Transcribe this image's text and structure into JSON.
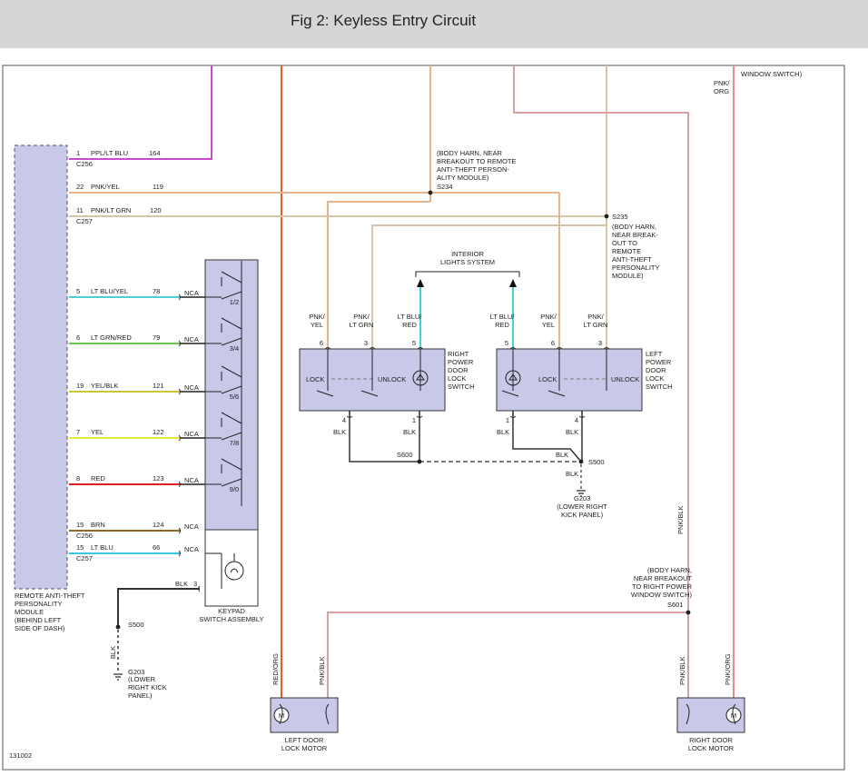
{
  "header": {
    "title": "Fig 2: Keyless Entry Circuit"
  },
  "colors": {
    "header_bg": "#d6d6d6",
    "component_fill": "#c8c8e8",
    "wire_ppl_lt_blu": "#c84ad0",
    "wire_pnk_yel": "#e8b48c",
    "wire_pnk_lt_grn": "#d8c4a8",
    "wire_lt_blu_yel": "#4ad0d0",
    "wire_lt_grn_red": "#6ac850",
    "wire_yel_blk": "#c8c830",
    "wire_yel": "#e6e640",
    "wire_red": "#e02020",
    "wire_brn": "#8b6a2a",
    "wire_lt_blu": "#38c8e0",
    "wire_blk": "#333333",
    "wire_pnk_blk": "#d8a0a0",
    "wire_red_org": "#e0602c",
    "wire_pnk_org": "#e89080"
  },
  "module": {
    "label_lines": [
      "REMOTE ANTI-THEFT",
      "PERSONALITY",
      "MODULE",
      "(BEHIND LEFT",
      "SIDE OF DASH)"
    ],
    "pins": [
      {
        "pin": "1",
        "color": "PPL/LT BLU",
        "circuit": "164",
        "connector": "C256"
      },
      {
        "pin": "22",
        "color": "PNK/YEL",
        "circuit": "119",
        "connector": ""
      },
      {
        "pin": "11",
        "color": "PNK/LT GRN",
        "circuit": "120",
        "connector": "C257"
      },
      {
        "pin": "5",
        "color": "LT BLU/YEL",
        "circuit": "78",
        "connector": ""
      },
      {
        "pin": "6",
        "color": "LT GRN/RED",
        "circuit": "79",
        "connector": ""
      },
      {
        "pin": "19",
        "color": "YEL/BLK",
        "circuit": "121",
        "connector": ""
      },
      {
        "pin": "7",
        "color": "YEL",
        "circuit": "122",
        "connector": ""
      },
      {
        "pin": "8",
        "color": "RED",
        "circuit": "123",
        "connector": ""
      },
      {
        "pin": "15",
        "color": "BRN",
        "circuit": "124",
        "connector": "C256"
      },
      {
        "pin": "15",
        "color": "LT BLU",
        "circuit": "66",
        "connector": "C257"
      }
    ]
  },
  "keypad": {
    "nca": "NCA",
    "buttons": [
      "1/2",
      "3/4",
      "5/6",
      "7/8",
      "9/0"
    ],
    "blk_label": "BLK",
    "blk_pin": "3",
    "label_lines": [
      "KEYPAD",
      "SWITCH ASSEMBLY"
    ]
  },
  "ground_left": {
    "splice": "S500",
    "wire": "BLK",
    "ground": "G203",
    "label_lines": [
      "(LOWER",
      "RIGHT KICK",
      "PANEL)"
    ]
  },
  "splice_s234": {
    "id": "S234",
    "label_lines": [
      "(BODY HARN, NEAR",
      "BREAKOUT TO REMOTE",
      "ANTI-THEFT PERSON-",
      "ALITY MODULE)"
    ]
  },
  "splice_s235": {
    "id": "S235",
    "label_lines": [
      "(BODY HARN,",
      "NEAR BREAK-",
      "OUT TO",
      "REMOTE",
      "ANTI-THEFT",
      "PERSONALITY",
      "MODULE)"
    ]
  },
  "interior": {
    "label_lines": [
      "INTERIOR",
      "LIGHTS SYSTEM"
    ]
  },
  "right_switch": {
    "label_lines": [
      "RIGHT",
      "POWER",
      "DOOR",
      "LOCK",
      "SWITCH"
    ],
    "wires": [
      {
        "pin": "6",
        "color_lines": [
          "PNK/",
          "YEL"
        ]
      },
      {
        "pin": "3",
        "color_lines": [
          "PNK/",
          "LT GRN"
        ]
      },
      {
        "pin": "5",
        "color_lines": [
          "LT BLU/",
          "RED"
        ]
      }
    ],
    "lock": "LOCK",
    "unlock": "UNLOCK",
    "bottom_pins": [
      "4",
      "1"
    ],
    "bottom_wires": [
      "BLK",
      "BLK"
    ]
  },
  "left_switch": {
    "label_lines": [
      "LEFT",
      "POWER",
      "DOOR",
      "LOCK",
      "SWITCH"
    ],
    "wires": [
      {
        "pin": "5",
        "color_lines": [
          "LT BLU/",
          "RED"
        ]
      },
      {
        "pin": "6",
        "color_lines": [
          "PNK/",
          "YEL"
        ]
      },
      {
        "pin": "3",
        "color_lines": [
          "PNK/",
          "LT GRN"
        ]
      }
    ],
    "lock": "LOCK",
    "unlock": "UNLOCK",
    "bottom_pins": [
      "1",
      "4"
    ],
    "bottom_wires": [
      "BLK",
      "BLK"
    ]
  },
  "splice_s600": {
    "id": "S600"
  },
  "splice_s500": {
    "id": "S500",
    "wire_in": "BLK",
    "wire_out": "BLK"
  },
  "ground_g203": {
    "id": "G203",
    "label_lines": [
      "(LOWER RIGHT",
      "KICK PANEL)"
    ]
  },
  "top_right": {
    "wire_lines": [
      "PNK/",
      "ORG"
    ],
    "ref": "WINDOW SWITCH)"
  },
  "splice_s601": {
    "id": "S601",
    "label_lines": [
      "(BODY HARN,",
      "NEAR BREAKOUT",
      "TO RIGHT POWER",
      "WINDOW SWITCH)"
    ]
  },
  "vertical_labels": {
    "pnk_blk_upper": "PNK/BLK",
    "red_org": "RED/ORG",
    "pnk_blk_left": "PNK/BLK",
    "pnk_blk_right": "PNK/BLK",
    "pnk_org": "PNK/ORG"
  },
  "motors": {
    "symbol": "M",
    "left_label_lines": [
      "LEFT DOOR",
      "LOCK MOTOR"
    ],
    "right_label_lines": [
      "RIGHT DOOR",
      "LOCK MOTOR"
    ]
  },
  "footer": {
    "code": "131002"
  }
}
